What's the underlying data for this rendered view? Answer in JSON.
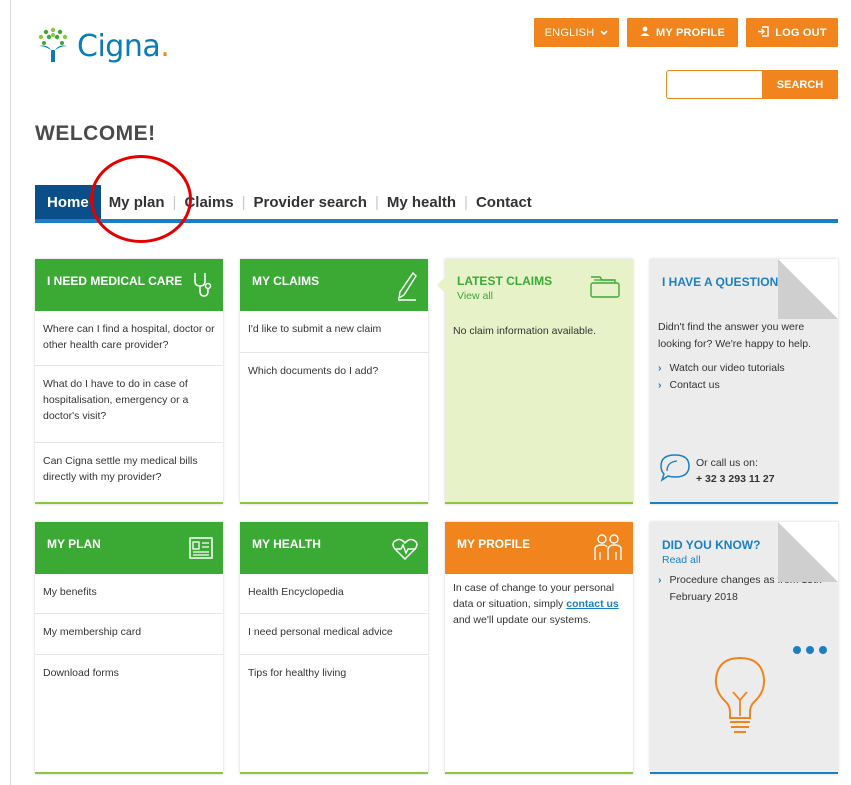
{
  "header": {
    "brand": "Cigna",
    "brand_dot": ".",
    "language": "ENGLISH",
    "my_profile": "MY PROFILE",
    "log_out": "LOG OUT",
    "search_label": "SEARCH",
    "search_value": ""
  },
  "welcome": "WELCOME!",
  "nav": {
    "items": [
      "Home",
      "My plan",
      "Claims",
      "Provider search",
      "My health",
      "Contact"
    ],
    "separator": "|"
  },
  "cards": {
    "medical_care": {
      "title": "I NEED MEDICAL CARE",
      "rows": [
        "Where can I find a hospital, doctor or other health care provider?",
        "What do I have to do in case of hospitalisation, emergency or a doctor's visit?",
        "Can Cigna settle my medical bills directly with my provider?"
      ]
    },
    "my_claims": {
      "title": "MY CLAIMS",
      "rows": [
        "I'd like to submit a new claim",
        "Which documents do I add?"
      ]
    },
    "latest_claims": {
      "title": "LATEST CLAIMS",
      "sub": "View all",
      "text": "No claim information available."
    },
    "question": {
      "title": "I HAVE A QUESTION",
      "text": "Didn't find the answer you were looking for? We're happy to help.",
      "links": [
        "Watch our video tutorials",
        "Contact us"
      ],
      "call_label": "Or call us on:",
      "phone": "+ 32 3 293 11 27"
    },
    "my_plan": {
      "title": "MY PLAN",
      "rows": [
        "My benefits",
        "My membership card",
        "Download forms"
      ]
    },
    "my_health": {
      "title": "MY HEALTH",
      "rows": [
        "Health Encyclopedia",
        "I need personal medical advice",
        "Tips for healthy living"
      ]
    },
    "my_profile": {
      "title": "MY PROFILE",
      "text_before": "In case of change to your personal data or situation, simply",
      "link": "contact us",
      "text_after": "and we'll update our systems."
    },
    "did_you_know": {
      "title": "DID YOU KNOW?",
      "sub": "Read all",
      "item": "Procedure changes as from 15th February 2018"
    }
  },
  "colors": {
    "brand_blue": "#0a7db8",
    "orange": "#f2841e",
    "green": "#3aaa35",
    "nav_blue": "#0b4f8a",
    "annotation_red": "#e50000"
  },
  "icons": [
    "tree-logo-icon",
    "chevron-down-icon",
    "user-icon",
    "logout-icon",
    "stethoscope-icon",
    "pen-icon",
    "folder-icon",
    "newspaper-icon",
    "heartbeat-icon",
    "people-icon",
    "chat-bubble-icon",
    "lightbulb-icon",
    "more-dots-icon"
  ]
}
